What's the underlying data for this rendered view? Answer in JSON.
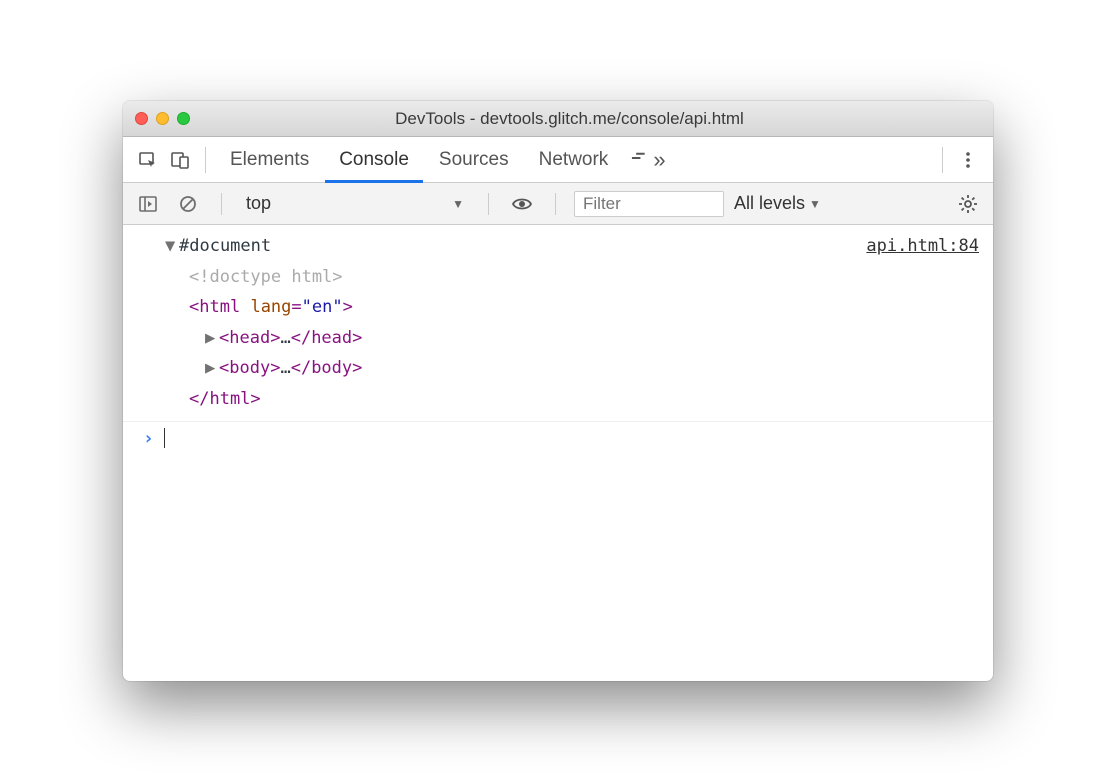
{
  "window": {
    "title": "DevTools - devtools.glitch.me/console/api.html"
  },
  "tabs": {
    "elements": "Elements",
    "console": "Console",
    "sources": "Sources",
    "network": "Network",
    "active": "Console"
  },
  "toolbar": {
    "context": "top",
    "filter_placeholder": "Filter",
    "levels_label": "All levels"
  },
  "console": {
    "source_link": "api.html:84",
    "root_label": "#document",
    "doctype_text": "<!doctype html>",
    "html_open_tag": "html",
    "html_attr_name": "lang",
    "html_attr_val": "\"en\"",
    "head_tag": "head",
    "body_tag": "body",
    "ellipsis": "…",
    "html_close": "</html>"
  }
}
